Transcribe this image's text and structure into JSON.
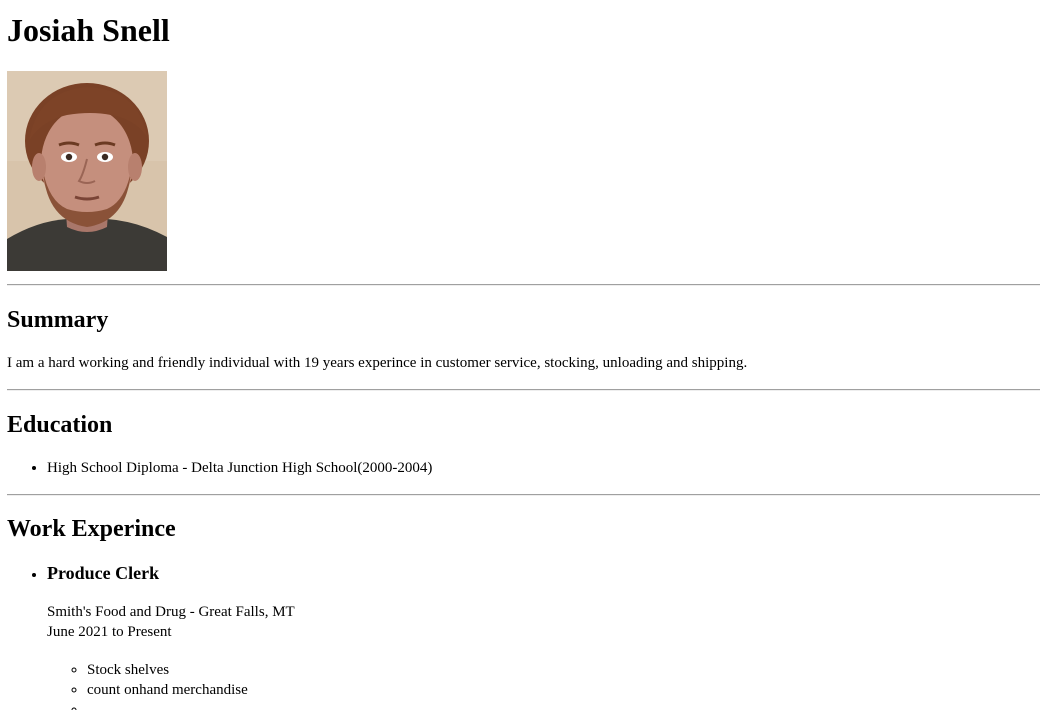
{
  "header": {
    "name": "Josiah Snell"
  },
  "summary": {
    "heading": "Summary",
    "text": "I am a hard working and friendly individual with 19 years experince in customer service, stocking, unloading and shipping."
  },
  "education": {
    "heading": "Education",
    "items": [
      "High School Diploma - Delta Junction High School(2000-2004)"
    ]
  },
  "work": {
    "heading": "Work Experince",
    "jobs": [
      {
        "title": "Produce Clerk",
        "employer": "Smith's Food and Drug - Great Falls, MT",
        "dates": "June 2021 to Present",
        "duties": [
          "Stock shelves",
          "count onhand merchandise",
          "... "
        ]
      }
    ]
  }
}
